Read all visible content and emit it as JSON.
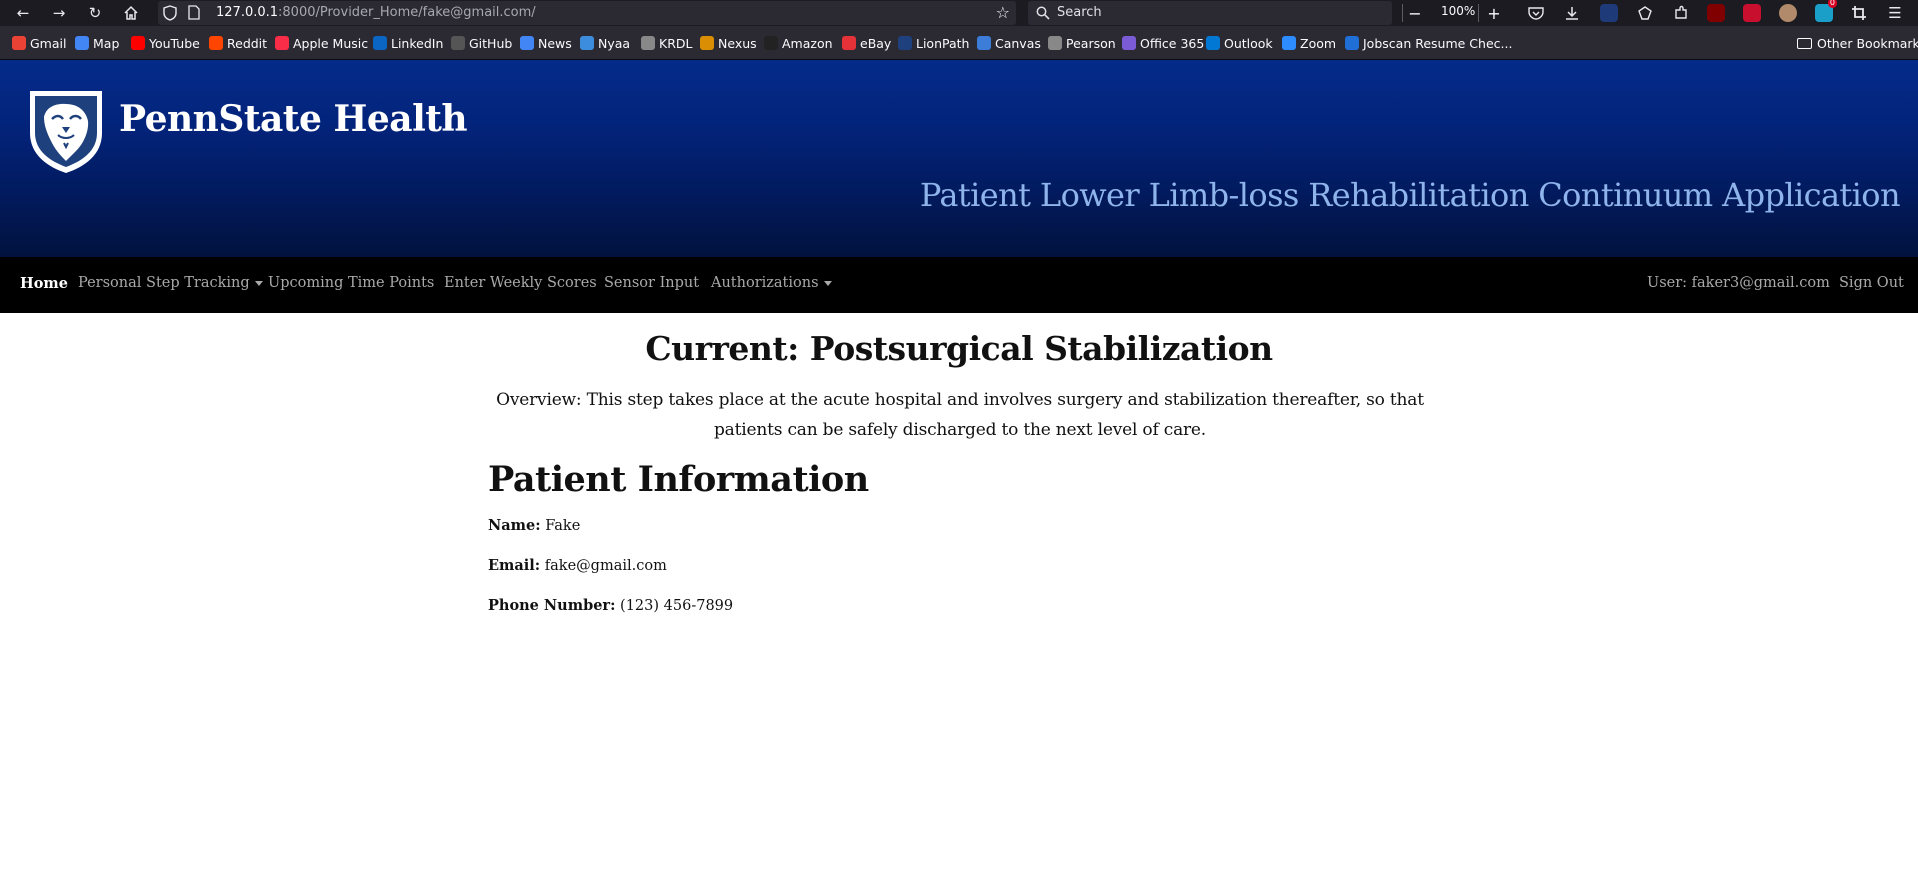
{
  "browser": {
    "url_host": "127.0.0.1",
    "url_rest": ":8000/Provider_Home/fake@gmail.com/",
    "search_placeholder": "Search",
    "zoom": "100%",
    "notification_count": "0",
    "bookmarks": [
      {
        "label": "Gmail",
        "color": "#ea4335"
      },
      {
        "label": "Map",
        "color": "#4285f4"
      },
      {
        "label": "YouTube",
        "color": "#ff0000"
      },
      {
        "label": "Reddit",
        "color": "#ff4500"
      },
      {
        "label": "Apple Music",
        "color": "#fa2d48"
      },
      {
        "label": "LinkedIn",
        "color": "#0a66c2"
      },
      {
        "label": "GitHub",
        "color": "#555555"
      },
      {
        "label": "News",
        "color": "#4285f4"
      },
      {
        "label": "Nyaa",
        "color": "#3c8dde"
      },
      {
        "label": "KRDL",
        "color": "#888888"
      },
      {
        "label": "Nexus",
        "color": "#d98e04"
      },
      {
        "label": "Amazon",
        "color": "#222222"
      },
      {
        "label": "eBay",
        "color": "#e53238"
      },
      {
        "label": "LionPath",
        "color": "#1e407c"
      },
      {
        "label": "Canvas",
        "color": "#3b7dd8"
      },
      {
        "label": "Pearson",
        "color": "#888888"
      },
      {
        "label": "Office 365",
        "color": "#7b5cd6"
      },
      {
        "label": "Outlook",
        "color": "#0078d4"
      },
      {
        "label": "Zoom",
        "color": "#2d8cff"
      },
      {
        "label": "Jobscan Resume Chec...",
        "color": "#1f6fd6"
      }
    ],
    "other_bookmarks": "Other Bookmarks"
  },
  "header": {
    "logo_text": "PennState Health",
    "app_title": "Patient Lower Limb-loss Rehabilitation Continuum Application",
    "gradient_top": "#042b8a",
    "gradient_bottom": "#01123d",
    "title_color": "#8fb4ec"
  },
  "nav": {
    "home": "Home",
    "personal_step_tracking": "Personal Step Tracking",
    "upcoming_time_points": "Upcoming Time Points",
    "enter_weekly_scores": "Enter Weekly Scores",
    "sensor_input": "Sensor Input",
    "authorizations": "Authorizations",
    "user": "User: faker3@gmail.com",
    "sign_out": "Sign Out"
  },
  "main": {
    "current_title": "Current: Postsurgical Stabilization",
    "overview": "Overview: This step takes place at the acute hospital and involves surgery and stabilization thereafter, so that patients can be safely discharged to the next level of care.",
    "patient_info_title": "Patient Information",
    "name_label": "Name:",
    "name_value": "Fake",
    "email_label": "Email:",
    "email_value": "fake@gmail.com",
    "phone_label": "Phone Number:",
    "phone_value": "(123) 456-7899"
  }
}
